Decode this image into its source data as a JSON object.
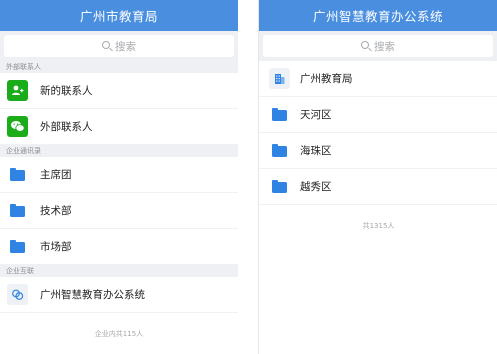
{
  "left": {
    "title": "广州市教育局",
    "search_placeholder": "搜索",
    "sections": [
      {
        "header": "外部联系人",
        "items": [
          {
            "label": "新的联系人",
            "icon": "add-contact-icon"
          },
          {
            "label": "外部联系人",
            "icon": "wechat-icon"
          }
        ]
      },
      {
        "header": "企业通讯录",
        "items": [
          {
            "label": "主席团",
            "icon": "folder-icon"
          },
          {
            "label": "技术部",
            "icon": "folder-icon"
          },
          {
            "label": "市场部",
            "icon": "folder-icon"
          }
        ]
      },
      {
        "header": "企业互联",
        "items": [
          {
            "label": "广州智慧教育办公系统",
            "icon": "linked-org-icon"
          }
        ]
      }
    ],
    "footer": "企业内共115人"
  },
  "right": {
    "title": "广州智慧教育办公系统",
    "search_placeholder": "搜索",
    "items": [
      {
        "label": "广州教育局",
        "icon": "building-icon"
      },
      {
        "label": "天河区",
        "icon": "folder-icon"
      },
      {
        "label": "海珠区",
        "icon": "folder-icon"
      },
      {
        "label": "越秀区",
        "icon": "folder-icon"
      }
    ],
    "footer": "共1315人"
  },
  "colors": {
    "nav_bar": "#4a8ee0",
    "folder": "#2f84e3",
    "green": "#1aad19",
    "section_bg": "#eef0f3"
  }
}
